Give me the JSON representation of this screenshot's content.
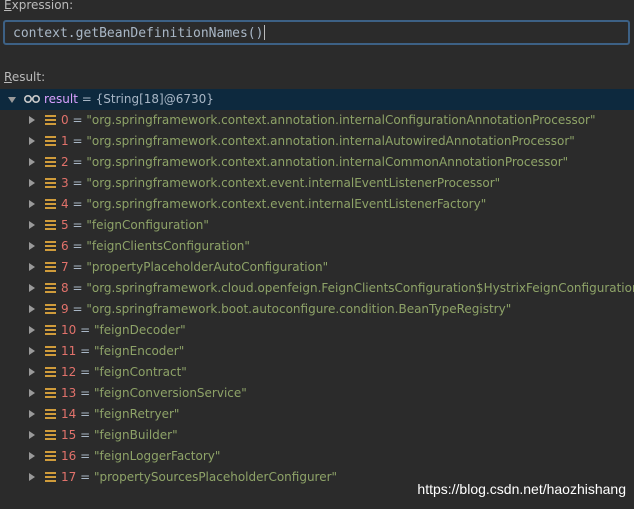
{
  "expression": {
    "label_prefix": "E",
    "label_rest": "xpression:",
    "value": "context.getBeanDefinitionNames()"
  },
  "result": {
    "label_prefix": "R",
    "label_rest": "esult:",
    "name": "result",
    "type": "= {String[18]@6730}",
    "items": [
      {
        "index": "0",
        "value": "\"org.springframework.context.annotation.internalConfigurationAnnotationProcessor\""
      },
      {
        "index": "1",
        "value": "\"org.springframework.context.annotation.internalAutowiredAnnotationProcessor\""
      },
      {
        "index": "2",
        "value": "\"org.springframework.context.annotation.internalCommonAnnotationProcessor\""
      },
      {
        "index": "3",
        "value": "\"org.springframework.context.event.internalEventListenerProcessor\""
      },
      {
        "index": "4",
        "value": "\"org.springframework.context.event.internalEventListenerFactory\""
      },
      {
        "index": "5",
        "value": "\"feignConfiguration\""
      },
      {
        "index": "6",
        "value": "\"feignClientsConfiguration\""
      },
      {
        "index": "7",
        "value": "\"propertyPlaceholderAutoConfiguration\""
      },
      {
        "index": "8",
        "value": "\"org.springframework.cloud.openfeign.FeignClientsConfiguration$HystrixFeignConfiguration\""
      },
      {
        "index": "9",
        "value": "\"org.springframework.boot.autoconfigure.condition.BeanTypeRegistry\""
      },
      {
        "index": "10",
        "value": "\"feignDecoder\""
      },
      {
        "index": "11",
        "value": "\"feignEncoder\""
      },
      {
        "index": "12",
        "value": "\"feignContract\""
      },
      {
        "index": "13",
        "value": "\"feignConversionService\""
      },
      {
        "index": "14",
        "value": "\"feignRetryer\""
      },
      {
        "index": "15",
        "value": "\"feignBuilder\""
      },
      {
        "index": "16",
        "value": "\"feignLoggerFactory\""
      },
      {
        "index": "17",
        "value": "\"propertySourcesPlaceholderConfigurer\""
      }
    ]
  },
  "watermark": "https://blog.csdn.net/haozhishang",
  "colors": {
    "background": "#2b2b2b",
    "selected_row": "#0d293e",
    "index": "#e2726b",
    "string": "#8ea368",
    "icon": "#d09c3b"
  }
}
